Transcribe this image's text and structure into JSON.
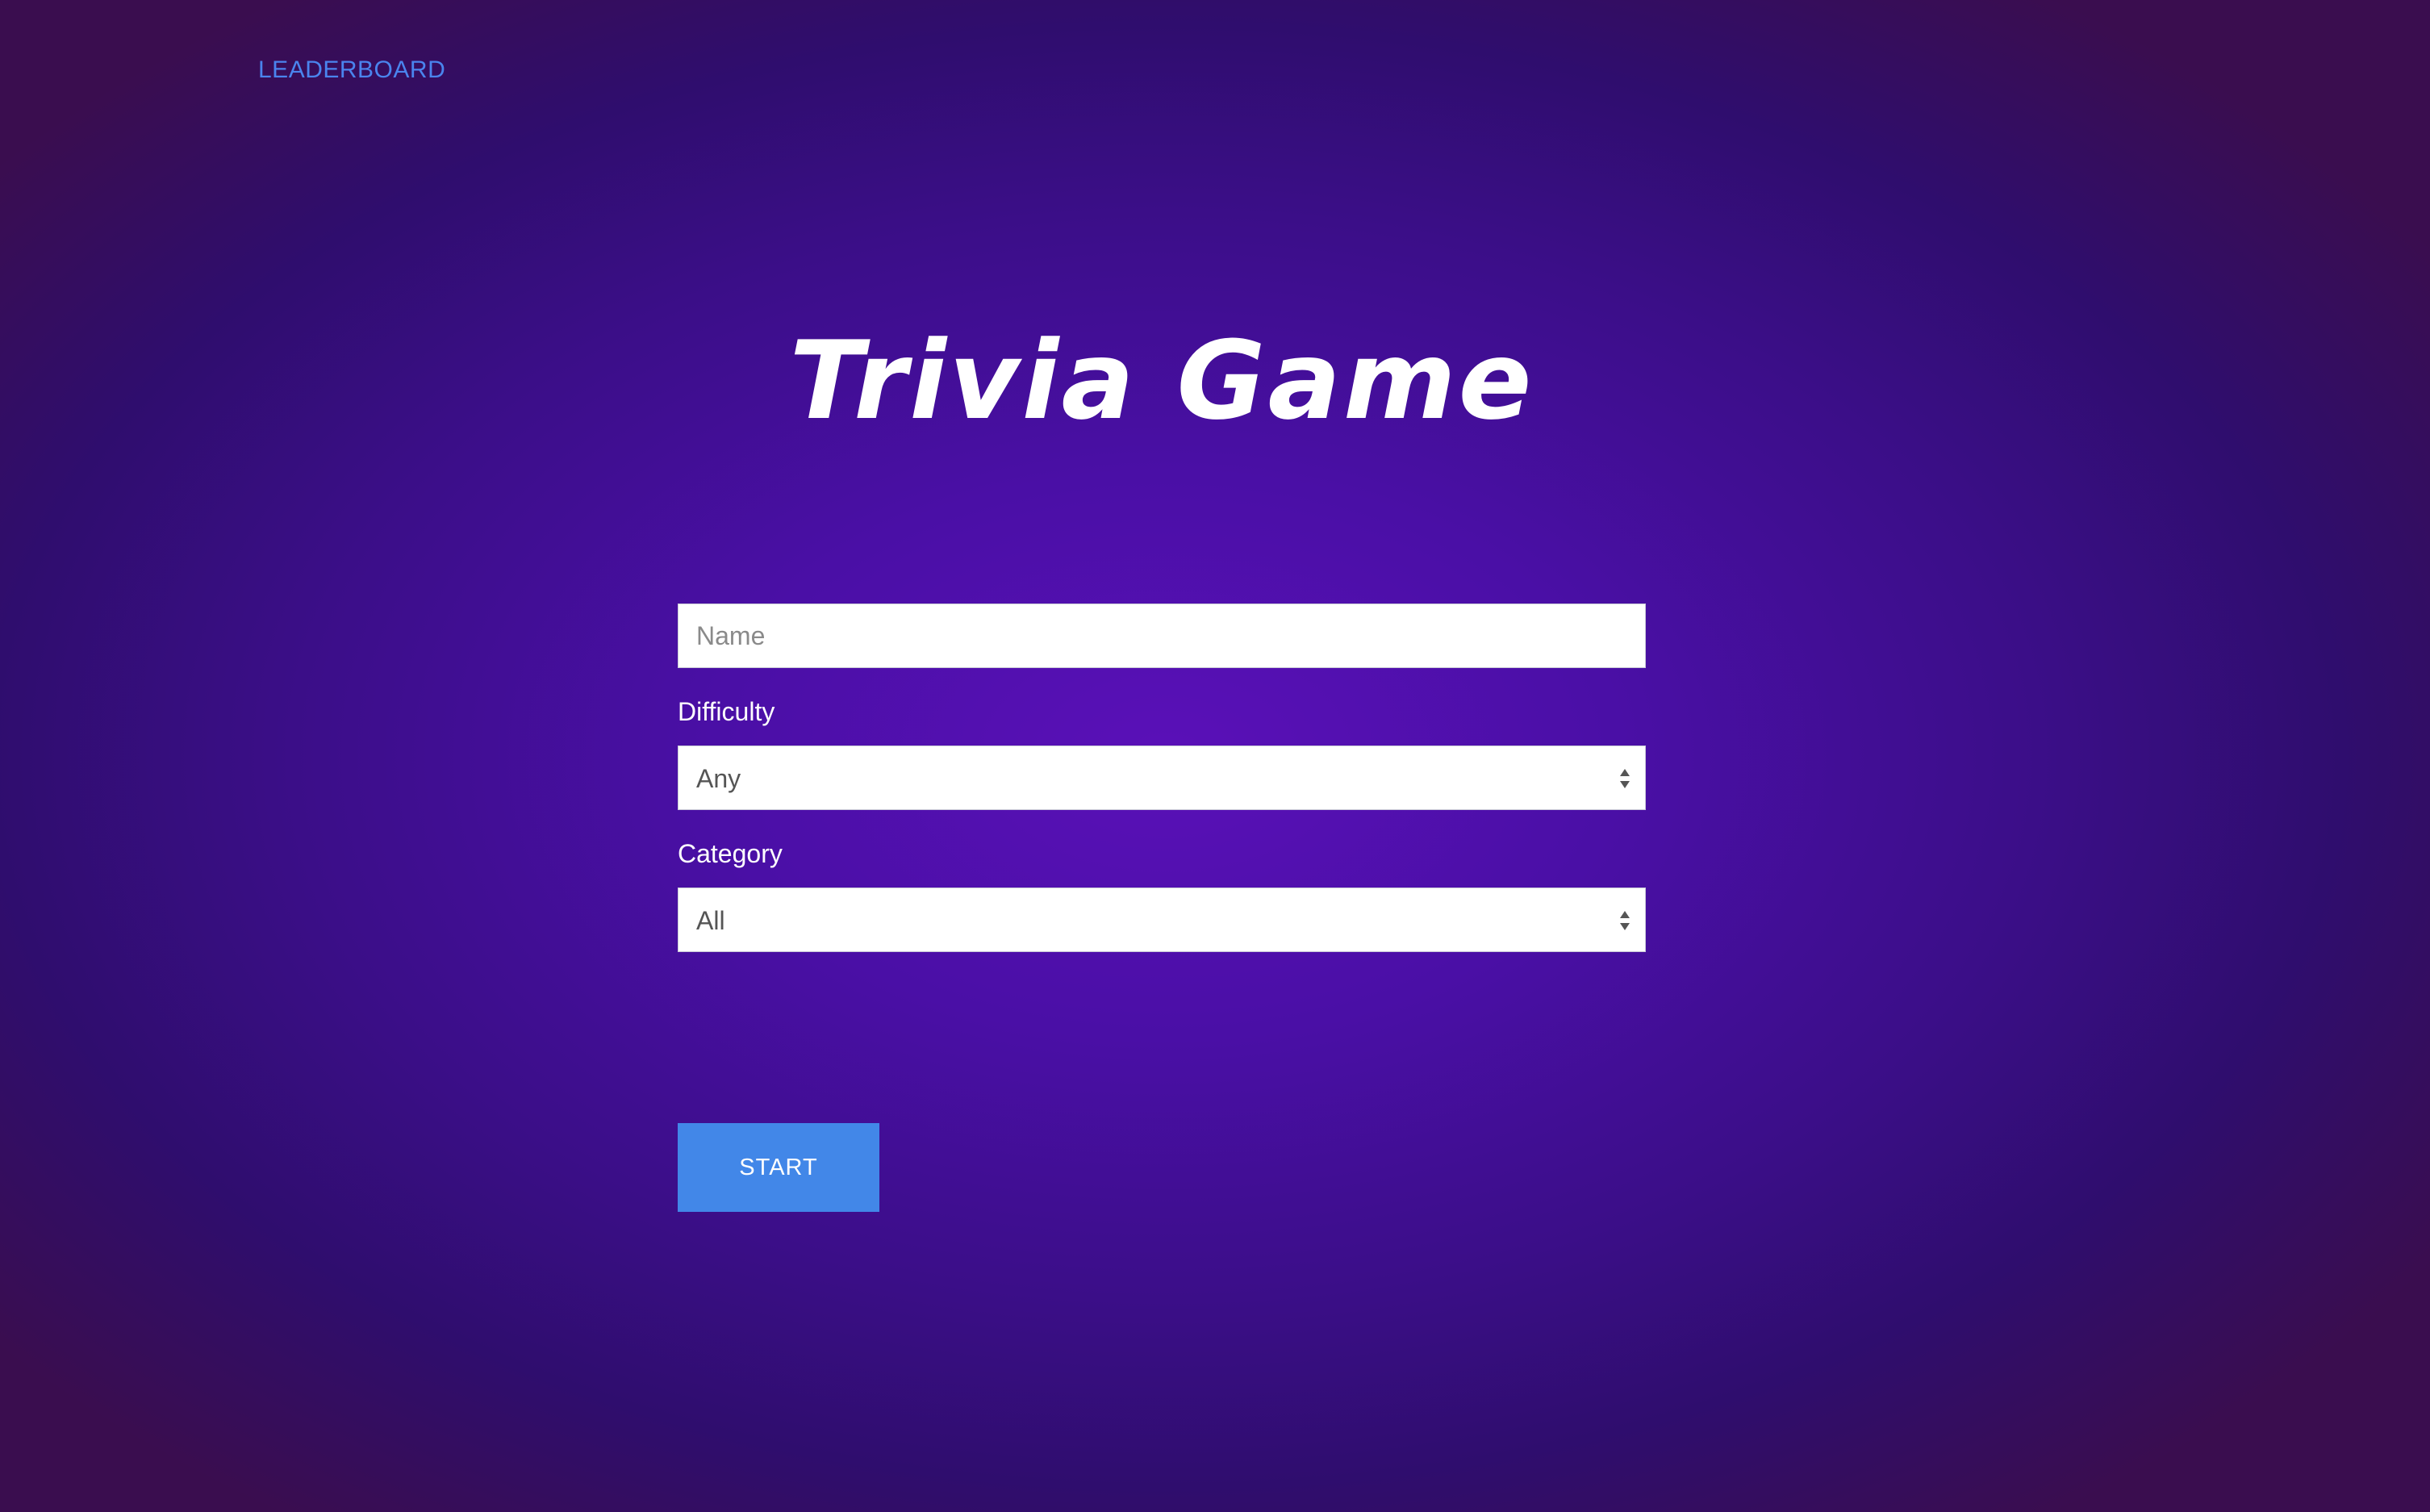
{
  "nav": {
    "leaderboard_label": "LEADERBOARD"
  },
  "header": {
    "title": "Trivia Game"
  },
  "form": {
    "name_placeholder": "Name",
    "name_value": "",
    "difficulty_label": "Difficulty",
    "difficulty_value": "Any",
    "category_label": "Category",
    "category_value": "All",
    "start_label": "START"
  },
  "colors": {
    "accent": "#4287e8",
    "link": "#4a84ee",
    "background_center": "#5a10b8",
    "background_edge": "#3a0d4f"
  },
  "icons": {
    "select_arrows": "updown-arrows-icon"
  }
}
